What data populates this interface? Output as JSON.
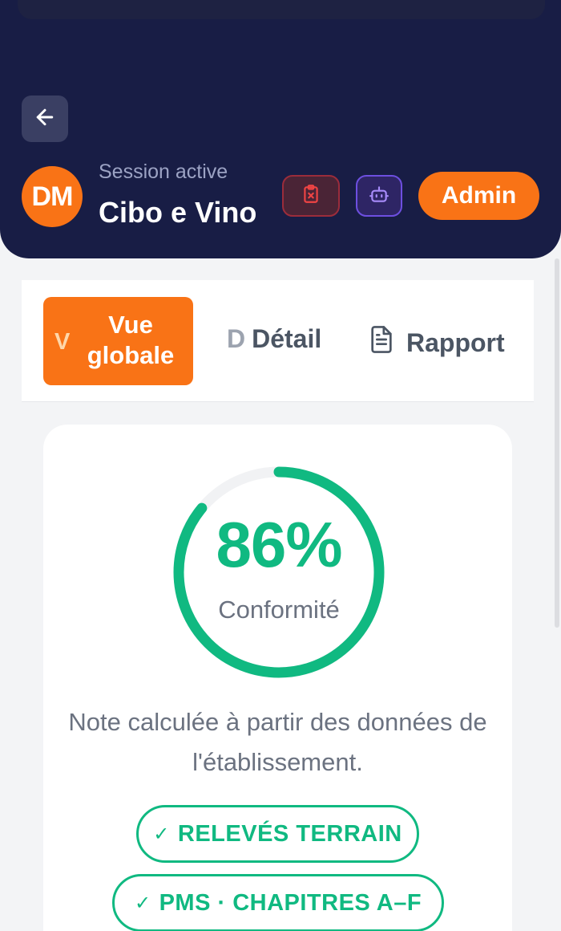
{
  "header": {
    "avatar_initials": "DM",
    "session_label": "Session active",
    "session_name": "Cibo e Vino",
    "admin_label": "Admin",
    "icons": {
      "back": "arrow-left-icon",
      "clipboard": "clipboard-x-icon",
      "bot": "bot-icon"
    }
  },
  "tabs": [
    {
      "letter": "V",
      "label": "Vue globale",
      "active": true
    },
    {
      "letter": "D",
      "label": "Détail",
      "active": false
    },
    {
      "icon": "file-text-icon",
      "label": "Rapport",
      "active": false
    }
  ],
  "score": {
    "value_text": "86%",
    "value": 86,
    "label": "Conformité"
  },
  "note": "Note calculée à partir des données de l'établissement.",
  "badges": [
    {
      "label": "RELEVÉS TERRAIN"
    },
    {
      "label": "PMS · CHAPITRES A–F"
    }
  ],
  "colors": {
    "header_bg": "#181d45",
    "accent": "#f97316",
    "success": "#10b981",
    "danger": "#9b2c3b",
    "bot_accent": "#6d4fe0"
  }
}
